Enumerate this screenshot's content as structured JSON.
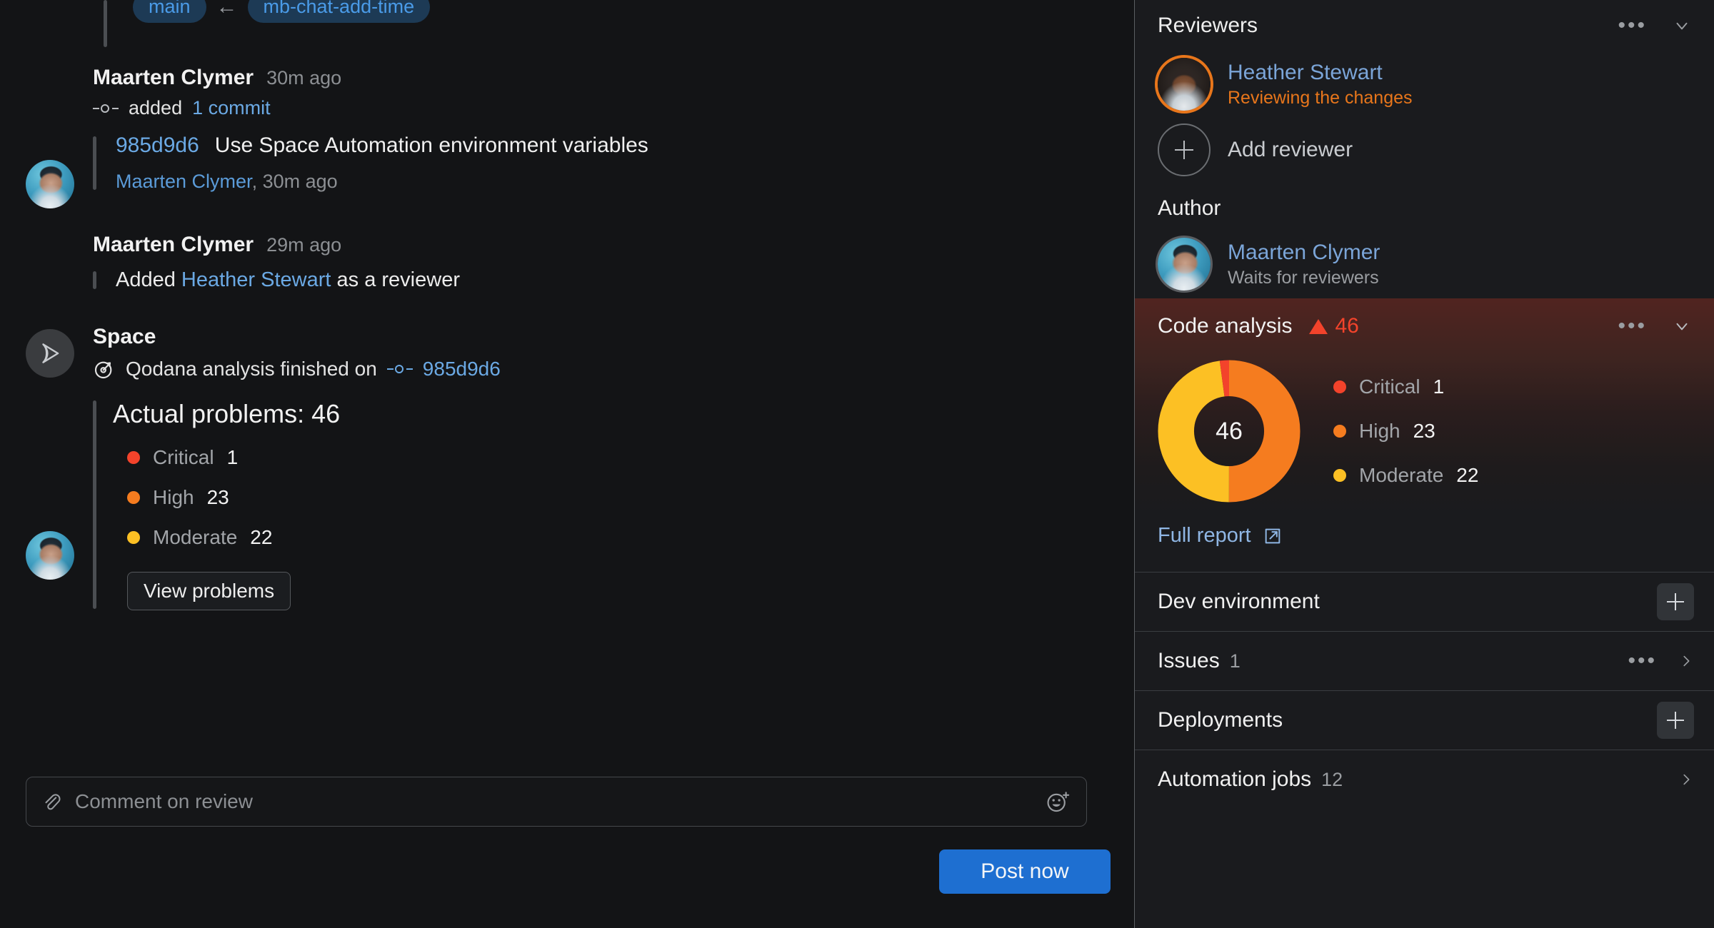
{
  "main": {
    "branch": {
      "target": "main",
      "arrow": "←",
      "source": "mb-chat-add-time"
    },
    "events": [
      {
        "author": "Maarten Clymer",
        "time": "30m ago",
        "action_prefix": "added",
        "action_link": "1 commit",
        "commit_hash": "985d9d6",
        "commit_message": "Use Space Automation environment variables",
        "commit_author": "Maarten Clymer",
        "commit_sep": ", ",
        "commit_time": "30m ago"
      },
      {
        "author": "Maarten Clymer",
        "time": "29m ago",
        "text_before": "Added ",
        "reviewer_link": "Heather Stewart",
        "text_after": " as a reviewer"
      }
    ],
    "space_message": {
      "title": "Space",
      "subtitle_prefix": "Qodana analysis finished on",
      "commit_hash": "985d9d6",
      "analysis_title": "Actual problems: 46",
      "severities": [
        {
          "label": "Critical",
          "count": "1",
          "color": "#f3432b"
        },
        {
          "label": "High",
          "count": "23",
          "color": "#f57c1f"
        },
        {
          "label": "Moderate",
          "count": "22",
          "color": "#fcc024"
        }
      ],
      "view_problems_label": "View problems"
    },
    "composer": {
      "placeholder": "Comment on review",
      "attach_icon": "paperclip-icon",
      "emoji_icon": "emoji-add-icon"
    },
    "post_button_label": "Post now"
  },
  "sidebar": {
    "reviewers": {
      "title": "Reviewers",
      "more_icon": "ellipsis-icon",
      "collapse_icon": "chevron-down-icon",
      "people": [
        {
          "name": "Heather Stewart",
          "status": "Reviewing the changes",
          "status_color": "#e8761b"
        }
      ],
      "add_label": "Add reviewer"
    },
    "author": {
      "title": "Author",
      "name": "Maarten Clymer",
      "status": "Waits for reviewers"
    },
    "code_analysis": {
      "title": "Code analysis",
      "badge_count": "46",
      "badge_color": "#f3432b",
      "more_icon": "ellipsis-icon",
      "collapse_icon": "chevron-down-icon",
      "donut_total": "46",
      "legend": [
        {
          "label": "Critical",
          "count": "1",
          "color": "#f3432b"
        },
        {
          "label": "High",
          "count": "23",
          "color": "#f57c1f"
        },
        {
          "label": "Moderate",
          "count": "22",
          "color": "#fcc024"
        }
      ],
      "full_report_label": "Full report",
      "external_icon": "external-link-icon"
    },
    "rows": [
      {
        "label": "Dev environment",
        "count": "",
        "action": "plus"
      },
      {
        "label": "Issues",
        "count": "1",
        "action": "more-chevron"
      },
      {
        "label": "Deployments",
        "count": "",
        "action": "plus"
      },
      {
        "label": "Automation jobs",
        "count": "12",
        "action": "chevron"
      }
    ]
  },
  "chart_data": {
    "type": "pie",
    "title": "Code analysis problems",
    "categories": [
      "Critical",
      "High",
      "Moderate"
    ],
    "values": [
      1,
      23,
      22
    ],
    "colors": [
      "#f3432b",
      "#f57c1f",
      "#fcc024"
    ],
    "total": 46,
    "center_label": "46",
    "legend_position": "right",
    "donut": true
  }
}
